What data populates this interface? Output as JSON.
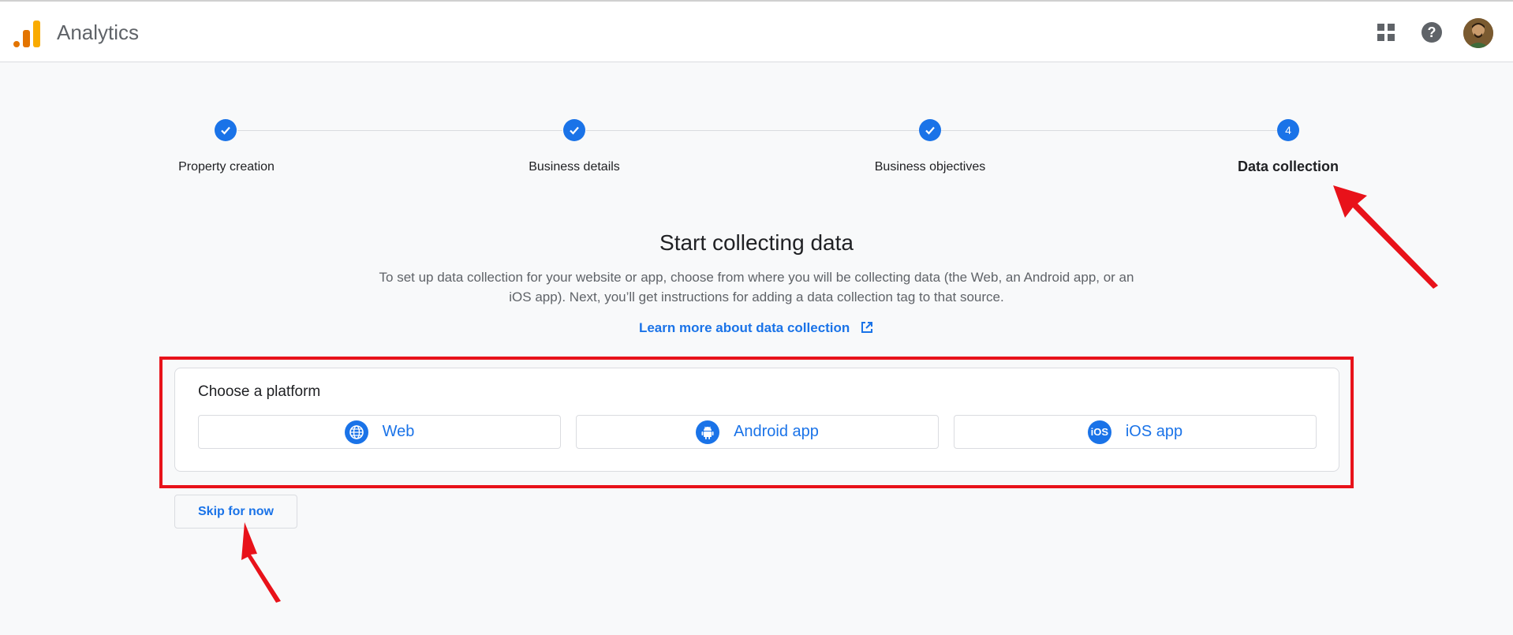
{
  "header": {
    "app_title": "Analytics",
    "icons": [
      "apps-grid-icon",
      "help-icon",
      "avatar"
    ]
  },
  "stepper": {
    "steps": [
      {
        "label": "Property creation",
        "state": "complete"
      },
      {
        "label": "Business details",
        "state": "complete"
      },
      {
        "label": "Business objectives",
        "state": "complete"
      },
      {
        "label": "Data collection",
        "state": "active",
        "number": "4"
      }
    ]
  },
  "main": {
    "title": "Start collecting data",
    "description": "To set up data collection for your website or app, choose from where you will be collecting data (the Web, an Android app, or an iOS app). Next, you’ll get instructions for adding a data collection tag to that source.",
    "learn_more": "Learn more about data collection"
  },
  "platform": {
    "heading": "Choose a platform",
    "options": [
      {
        "label": "Web",
        "icon": "globe-icon"
      },
      {
        "label": "Android app",
        "icon": "android-icon"
      },
      {
        "label": "iOS app",
        "icon": "ios-icon",
        "icon_text": "iOS"
      }
    ]
  },
  "skip_label": "Skip for now",
  "colors": {
    "accent": "#1a73e8",
    "annotation": "#e8121a"
  }
}
